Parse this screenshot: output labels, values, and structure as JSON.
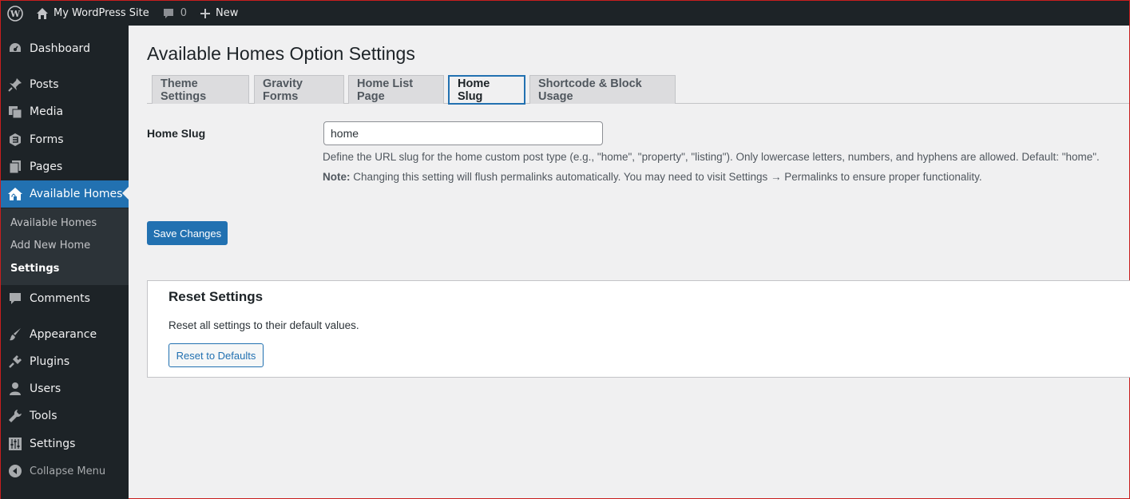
{
  "admin_bar": {
    "site_name": "My WordPress Site",
    "comment_count": "0",
    "new_label": "New"
  },
  "sidebar": {
    "items": [
      {
        "label": "Dashboard",
        "icon": "dashboard-icon"
      },
      {
        "label": "Posts",
        "icon": "pin-icon"
      },
      {
        "label": "Media",
        "icon": "media-icon"
      },
      {
        "label": "Forms",
        "icon": "forms-icon"
      },
      {
        "label": "Pages",
        "icon": "pages-icon"
      },
      {
        "label": "Available Homes",
        "icon": "homes-icon"
      },
      {
        "label": "Comments",
        "icon": "comment-icon"
      },
      {
        "label": "Appearance",
        "icon": "brush-icon"
      },
      {
        "label": "Plugins",
        "icon": "plug-icon"
      },
      {
        "label": "Users",
        "icon": "user-icon"
      },
      {
        "label": "Tools",
        "icon": "wrench-icon"
      },
      {
        "label": "Settings",
        "icon": "sliders-icon"
      },
      {
        "label": "Collapse Menu",
        "icon": "collapse-icon"
      }
    ],
    "submenu": [
      {
        "label": "Available Homes"
      },
      {
        "label": "Add New Home"
      },
      {
        "label": "Settings"
      }
    ],
    "accent_color": "#2271b1"
  },
  "main": {
    "title": "Available Homes Option Settings",
    "tabs": [
      {
        "label": "Theme Settings"
      },
      {
        "label": "Gravity Forms"
      },
      {
        "label": "Home List Page"
      },
      {
        "label": "Home Slug"
      },
      {
        "label": "Shortcode & Block Usage"
      }
    ],
    "active_tab": "Home Slug",
    "field": {
      "label": "Home Slug",
      "value": "home",
      "description": "Define the URL slug for the home custom post type (e.g., \"home\", \"property\", \"listing\"). Only lowercase letters, numbers, and hyphens are allowed. Default: \"home\".",
      "note_label": "Note:",
      "note_text": " Changing this setting will flush permalinks automatically. You may need to visit Settings → Permalinks to ensure proper functionality."
    },
    "save_label": "Save Changes",
    "reset": {
      "title": "Reset Settings",
      "text": "Reset all settings to their default values.",
      "button_label": "Reset to Defaults"
    }
  }
}
